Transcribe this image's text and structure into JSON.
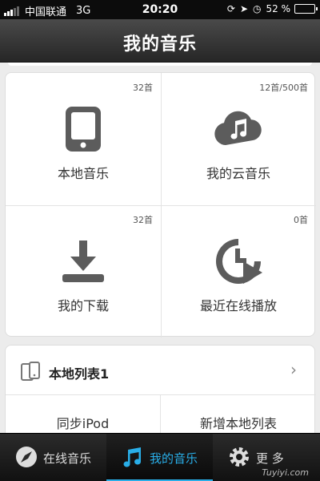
{
  "status_bar": {
    "carrier": "中国联通",
    "network": "3G",
    "time": "20:20",
    "battery": "52 %",
    "battery_level": 0.52
  },
  "nav": {
    "title": "我的音乐"
  },
  "tiles": [
    {
      "label": "本地音乐",
      "count": "32首",
      "icon": "tablet-icon"
    },
    {
      "label": "我的云音乐",
      "count": "12首/500首",
      "icon": "cloud-music-icon"
    },
    {
      "label": "我的下载",
      "count": "32首",
      "icon": "download-icon"
    },
    {
      "label": "最近在线播放",
      "count": "0首",
      "icon": "recent-play-icon"
    }
  ],
  "list": {
    "title": "本地列表1",
    "sync_label": "同步iPod",
    "new_list_label": "新增本地列表"
  },
  "tabs": [
    {
      "label": "在线音乐",
      "icon": "compass-icon"
    },
    {
      "label": "我的音乐",
      "icon": "music-note-icon"
    },
    {
      "label": "更  多",
      "icon": "gear-icon"
    }
  ],
  "watermark": "Tuyiyi.com",
  "colors": {
    "accent": "#29aee8",
    "icon_gray": "#5c5c5c"
  }
}
